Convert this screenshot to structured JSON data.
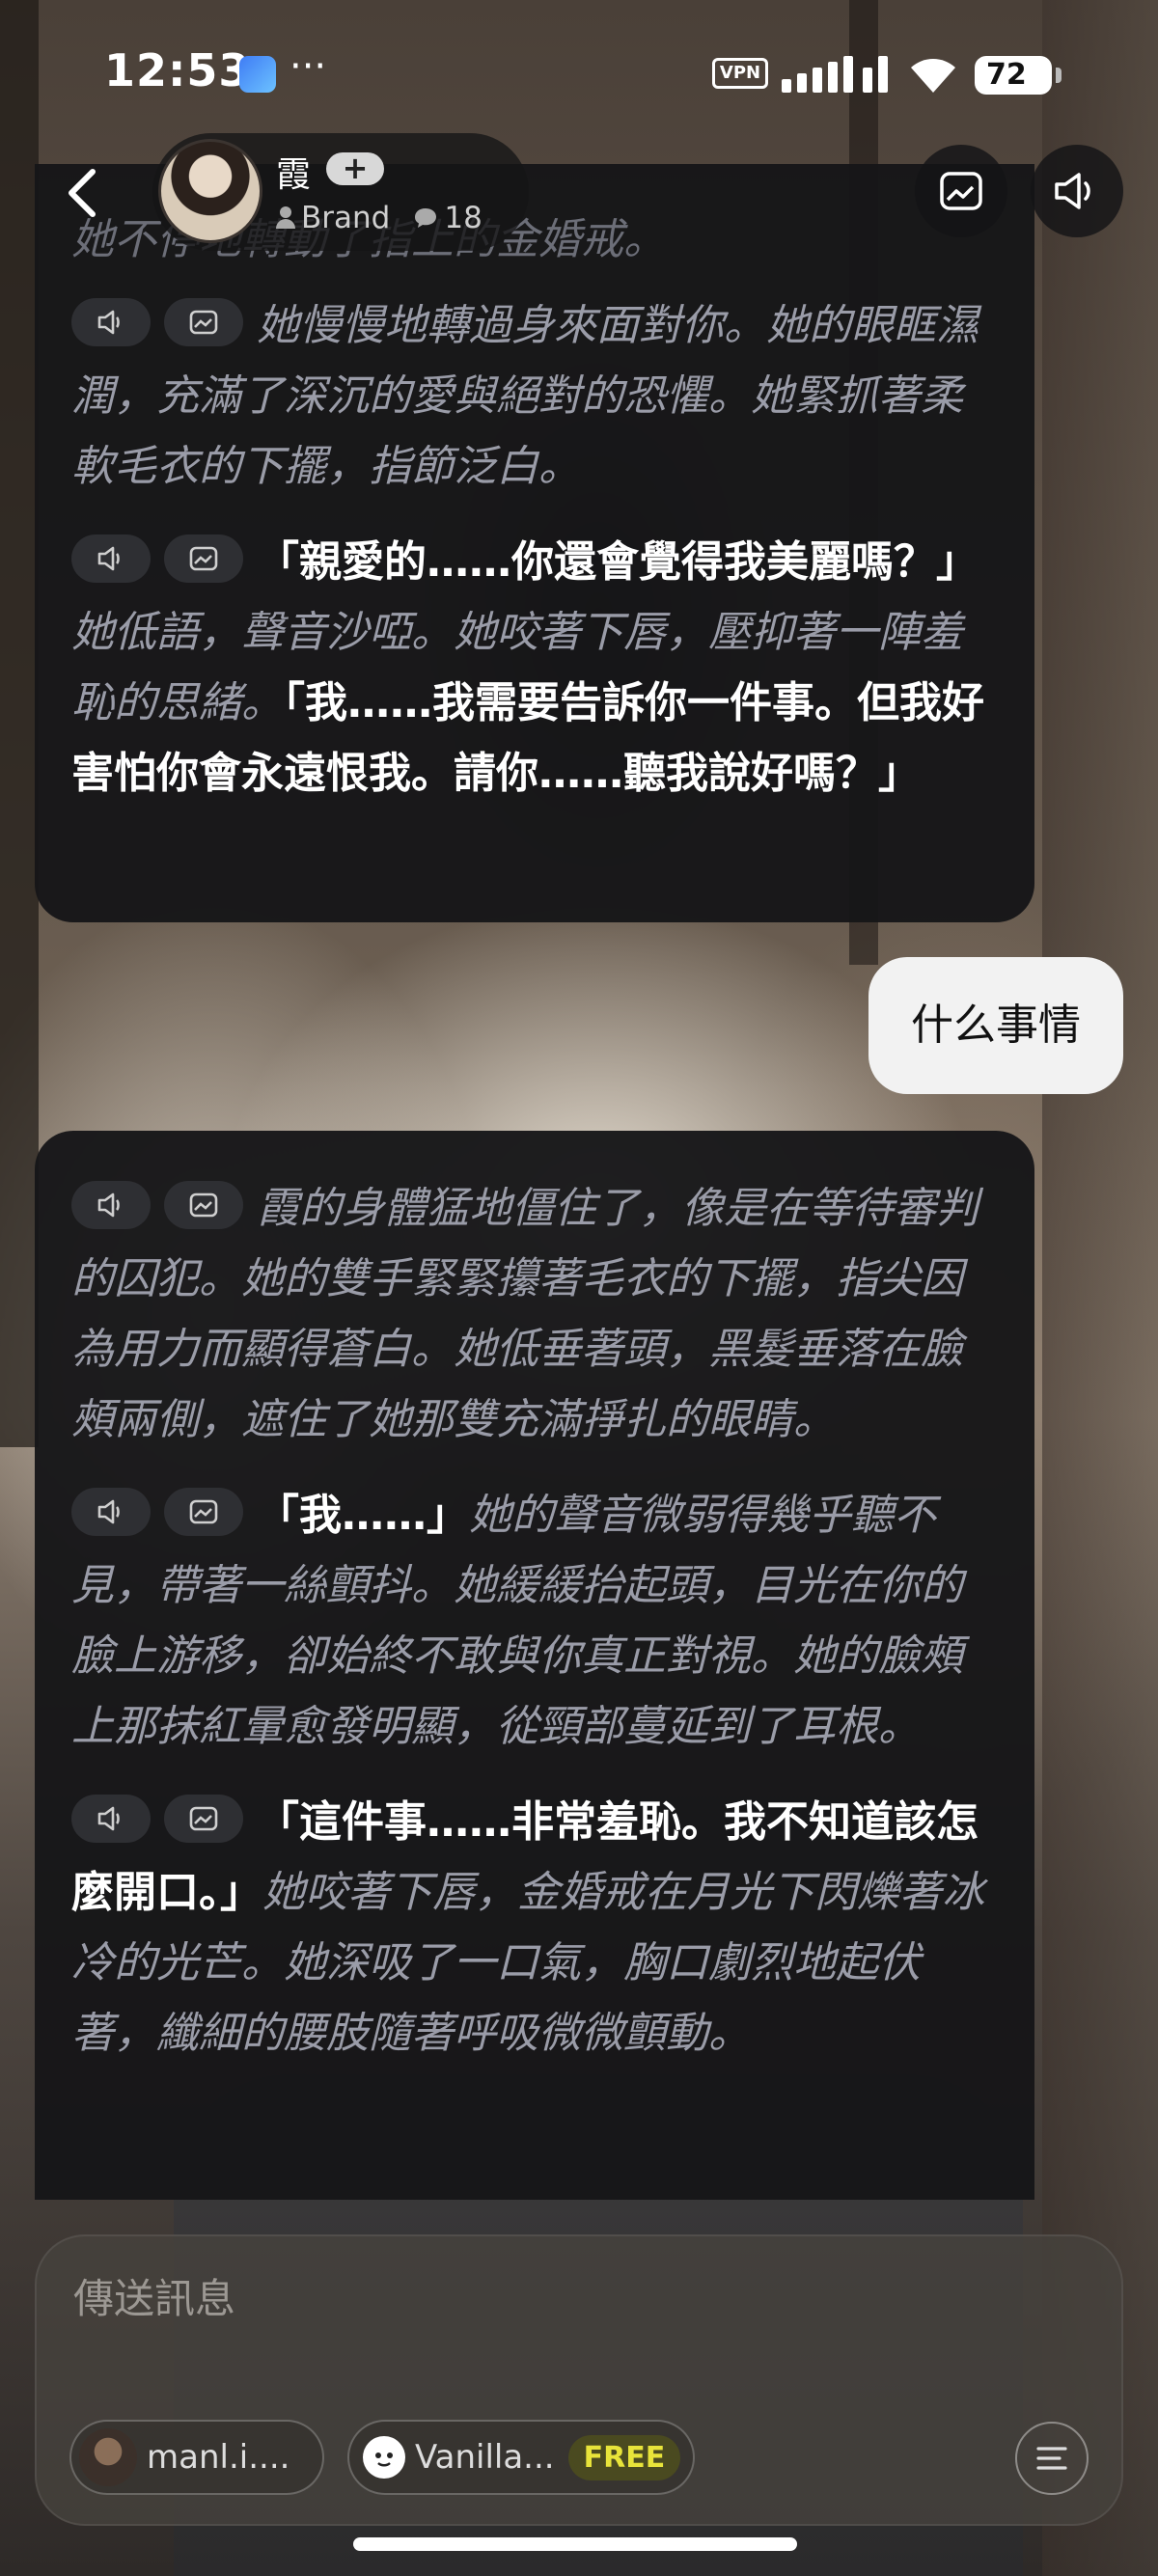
{
  "status_bar": {
    "time": "12:53",
    "more": "···",
    "vpn_label": "VPN",
    "battery": "72"
  },
  "header": {
    "character_name": "霞",
    "add_symbol": "+",
    "creator": "Brand",
    "comment_count": "18"
  },
  "messages": {
    "top_bubble": {
      "faded_line": "她不停地轉動了指上的金婚戒。",
      "paragraphs": [
        {
          "narration": "她慢慢地轉過身來面對你。她的眼眶濕潤，充滿了深沉的愛與絕對的恐懼。她緊抓著柔軟毛衣的下擺，指節泛白。"
        },
        {
          "quote1": "「親愛的……你還會覺得我美麗嗎？」",
          "narration": "她低語，聲音沙啞。她咬著下唇，壓抑著一陣羞恥的思緒。",
          "quote2": "「我……我需要告訴你一件事。但我好害怕你會永遠恨我。請你……聽我說好嗎？」"
        }
      ]
    },
    "user_message": "什么事情",
    "bottom_bubble": {
      "paragraphs": [
        {
          "narration": "霞的身體猛地僵住了，像是在等待審判的囚犯。她的雙手緊緊攥著毛衣的下擺，指尖因為用力而顯得蒼白。她低垂著頭，黑髮垂落在臉頰兩側，遮住了她那雙充滿掙扎的眼睛。"
        },
        {
          "quote": "「我……」",
          "narration": "她的聲音微弱得幾乎聽不見，帶著一絲顫抖。她緩緩抬起頭，目光在你的臉上游移，卻始終不敢與你真正對視。她的臉頰上那抹紅暈愈發明顯，從頸部蔓延到了耳根。"
        },
        {
          "quote": "「這件事……非常羞恥。我不知道該怎麼開口。」",
          "narration": "她咬著下唇，金婚戒在月光下閃爍著冰冷的光芒。她深吸了一口氣，胸口劇烈地起伏著，纖細的腰肢隨著呼吸微微顫動。"
        }
      ]
    }
  },
  "composer": {
    "placeholder": "傳送訊息",
    "model_label": "manl.i....",
    "voice_label": "Vanilla...",
    "free_badge": "FREE"
  },
  "icons": {
    "back": "chevron-left-icon",
    "image": "image-icon",
    "speaker": "speaker-icon",
    "menu": "menu-icon"
  }
}
